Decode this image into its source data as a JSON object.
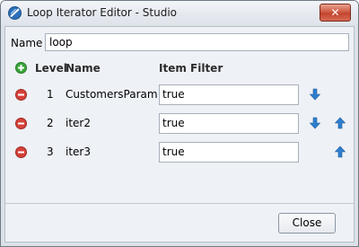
{
  "window": {
    "title": "Loop Iterator Editor - Studio"
  },
  "titlebar": {
    "close_glyph": "✕"
  },
  "form": {
    "name_label": "Name",
    "name_value": "loop"
  },
  "table": {
    "headers": {
      "level": "Level",
      "name": "Name",
      "item_filter": "Item Filter"
    },
    "rows": [
      {
        "level": "1",
        "name": "CustomersParam",
        "item_filter": "true",
        "move_down": true,
        "move_up": false
      },
      {
        "level": "2",
        "name": "iter2",
        "item_filter": "true",
        "move_down": true,
        "move_up": true
      },
      {
        "level": "3",
        "name": "iter3",
        "item_filter": "true",
        "move_down": false,
        "move_up": true
      }
    ]
  },
  "footer": {
    "close_label": "Close"
  },
  "icons": {
    "app": "studio-icon",
    "add": "add-icon",
    "remove": "remove-icon",
    "down": "arrow-down-icon",
    "up": "arrow-up-icon"
  },
  "colors": {
    "add_green": "#3aa63a",
    "remove_red": "#d6403a",
    "arrow_blue": "#2e7fd0",
    "window_close_red": "#c9503a"
  }
}
